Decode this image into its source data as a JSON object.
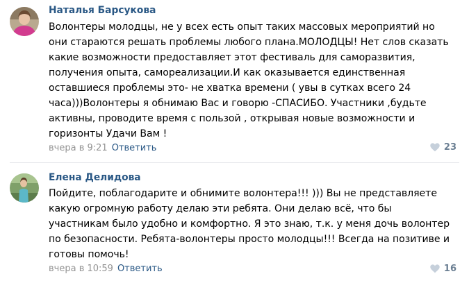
{
  "comments": [
    {
      "author": "Наталья Барсукова",
      "lines": [
        "Волонтеры молодцы, не у всех есть опыт таких массовых мероприятий но",
        "они стараются решать проблемы любого плана.МОЛОДЦЫ! Нет слов сказать",
        "какие возможности предоставляет этот фестиваль для саморазвития,",
        "получения опыта, самореализации.И как оказывается единственная",
        "оставшиеся проблемы это- не хватка времени ( увы в сутках всего 24",
        "часа)))Волонтеры я обнимаю Вас и говорю -СПАСИБО. Участники ,будьте",
        "активны, проводите время с пользой , открывая новые возможности и",
        "горизонты Удачи Вам !"
      ],
      "time": "вчера в 9:21",
      "reply_label": "Ответить",
      "likes": "23",
      "avatar_icon": "avatar-woman-pink-photo"
    },
    {
      "author": "Елена Делидова",
      "lines": [
        "Пойдите, поблагодарите и обнимите волонтера!!! ))) Вы не представляете",
        "какую огромную работу делаю эти ребята. Они делаю всё, что бы",
        "участникам было удобно и комфортно. Я это знаю, т.к. у меня дочь волонтер",
        "по безопасности. Ребята-волонтеры просто молодцы!!! Всегда на позитиве и",
        "готовы помочь!"
      ],
      "time": "вчера в 10:59",
      "reply_label": "Ответить",
      "likes": "16",
      "avatar_icon": "avatar-woman-outdoor-photo"
    }
  ],
  "colors": {
    "link": "#2a5885",
    "meta": "#939393",
    "like": "#6b7f93",
    "divider": "#e7e8ec"
  }
}
